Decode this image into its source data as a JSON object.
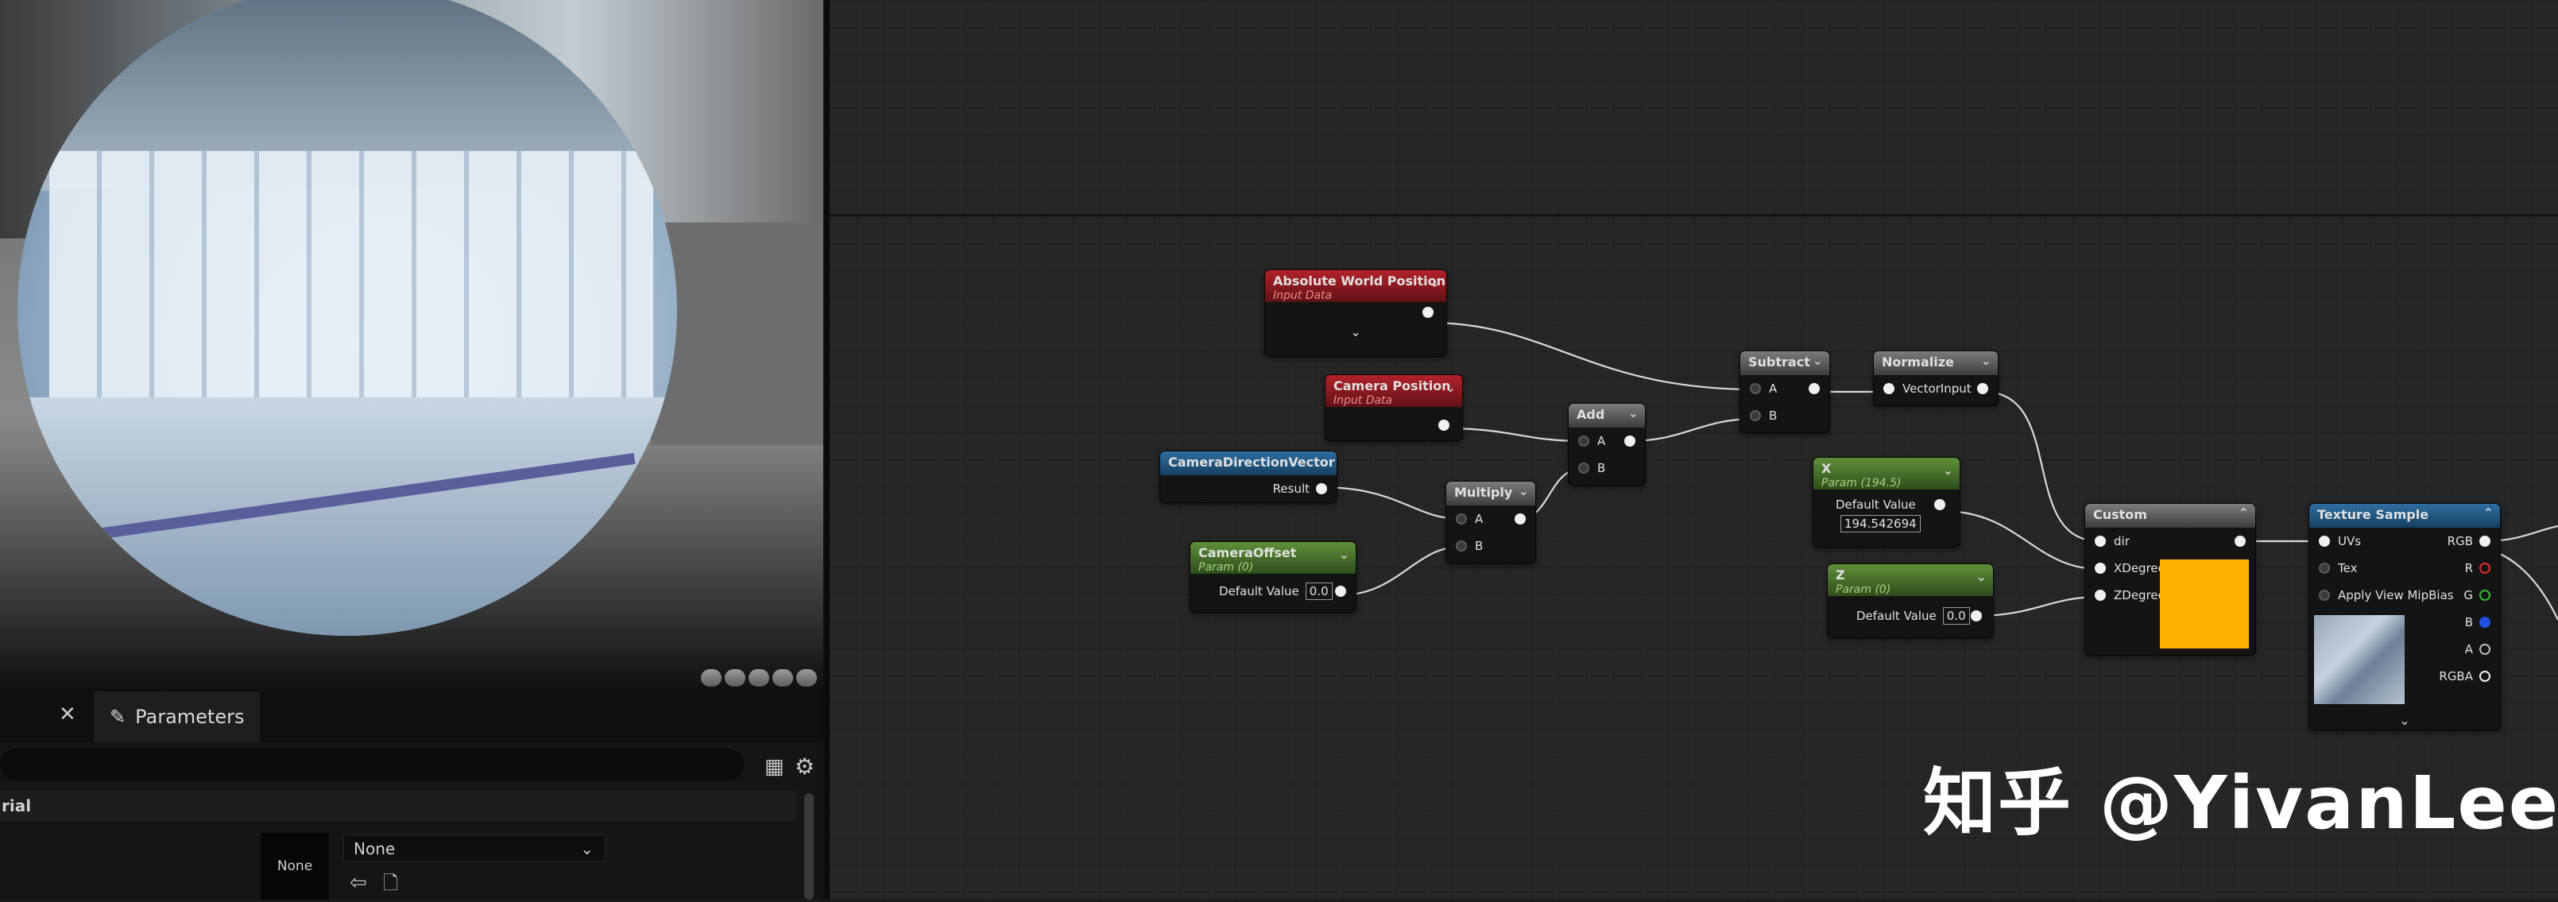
{
  "panel": {
    "tab_label": "Parameters",
    "section_label": "rial",
    "thumb_label": "None",
    "select_value": "None"
  },
  "nodes": {
    "absolute_world_position": {
      "title": "Absolute World Position",
      "subtitle": "Input Data"
    },
    "camera_position": {
      "title": "Camera Position",
      "subtitle": "Input Data"
    },
    "camera_direction_vector": {
      "title": "CameraDirectionVector",
      "out_label": "Result"
    },
    "camera_offset": {
      "title": "CameraOffset",
      "subtitle": "Param (0)",
      "dv_label": "Default Value",
      "dv_value": "0.0"
    },
    "multiply": {
      "title": "Multiply",
      "in_a": "A",
      "in_b": "B"
    },
    "add": {
      "title": "Add",
      "in_a": "A",
      "in_b": "B"
    },
    "subtract": {
      "title": "Subtract",
      "in_a": "A",
      "in_b": "B"
    },
    "normalize": {
      "title": "Normalize",
      "in_label": "VectorInput"
    },
    "x_param": {
      "title": "X",
      "subtitle": "Param (194.5)",
      "dv_label": "Default Value",
      "dv_value": "194.542694"
    },
    "z_param": {
      "title": "Z",
      "subtitle": "Param (0)",
      "dv_label": "Default Value",
      "dv_value": "0.0"
    },
    "custom": {
      "title": "Custom",
      "in_dir": "dir",
      "in_x": "XDegree",
      "in_z": "ZDegree",
      "swatch_color": "#ffb400"
    },
    "texture_sample": {
      "title": "Texture Sample",
      "in_uvs": "UVs",
      "in_tex": "Tex",
      "in_mip": "Apply View MipBias",
      "out_rgb": "RGB",
      "out_r": "R",
      "out_g": "G",
      "out_b": "B",
      "out_a": "A",
      "out_rgba": "RGBA"
    }
  },
  "colors": {
    "pin_r": "#e03030",
    "pin_g": "#30c030",
    "pin_b": "#2050e0"
  },
  "watermark": "知乎 @YivanLee"
}
